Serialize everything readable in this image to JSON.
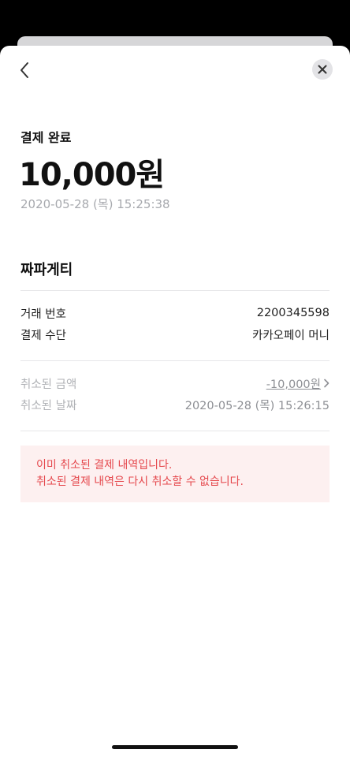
{
  "header": {
    "back_icon": "chevron-left-icon",
    "close_icon": "close-icon"
  },
  "payment": {
    "status_label": "결제 완료",
    "amount": "10,000원",
    "datetime": "2020-05-28 (목) 15:25:38",
    "merchant": "짜파게티"
  },
  "details": [
    {
      "label": "거래 번호",
      "value": "2200345598"
    },
    {
      "label": "결제 수단",
      "value": "카카오페이 머니"
    }
  ],
  "cancellation": {
    "amount_label": "취소된 금액",
    "amount_value": "-10,000원",
    "date_label": "취소된 날짜",
    "date_value": "2020-05-28 (목) 15:26:15"
  },
  "notice": {
    "line1": "이미 취소된 결제 내역입니다.",
    "line2": "취소된 결제 내역은 다시 취소할 수 없습니다.",
    "color": "#e5484d",
    "background": "#fdf0f0"
  }
}
